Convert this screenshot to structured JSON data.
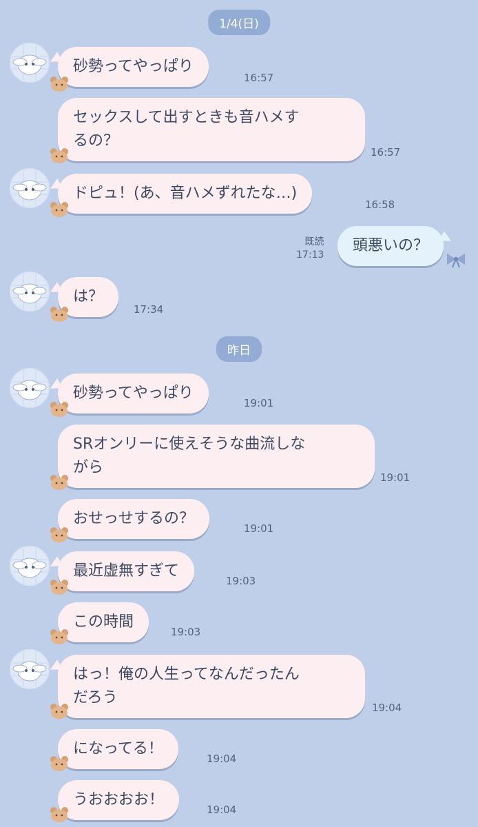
{
  "dates": [
    "1/4(日)",
    "昨日"
  ],
  "messages": [
    {
      "text": "砂勢ってやっぱり",
      "time": "16:57"
    },
    {
      "text": "セックスして出すときも音ハメす\nるの？",
      "time": "16:57"
    },
    {
      "text": "ドピュ！(あ、音ハメずれたな…)",
      "time": "16:58"
    },
    {
      "text": "頭悪いの？",
      "time": "17:13",
      "read": "既読"
    },
    {
      "text": "は？",
      "time": "17:34"
    },
    {
      "text": "砂勢ってやっぱり",
      "time": "19:01"
    },
    {
      "text": "SRオンリーに使えそうな曲流しな\nがら",
      "time": "19:01"
    },
    {
      "text": "おせっせするの？",
      "time": "19:01"
    },
    {
      "text": "最近虚無すぎて",
      "time": "19:03"
    },
    {
      "text": "この時間",
      "time": "19:03"
    },
    {
      "text": "はっ！俺の人生ってなんだったん\nだろう",
      "time": "19:04"
    },
    {
      "text": "になってる！",
      "time": "19:04"
    },
    {
      "text": "うおおおお！",
      "time": "19:04"
    }
  ],
  "icons": {
    "avatar": "cinnamoroll-avatar-icon",
    "badge": "bear-badge-icon",
    "bow": "ribbon-bow-icon"
  },
  "colors": {
    "background": "#bfcfe9",
    "incoming_bubble": "#fdeef2",
    "outgoing_bubble": "#e4f3fb",
    "date_pill": "#93acd5"
  }
}
